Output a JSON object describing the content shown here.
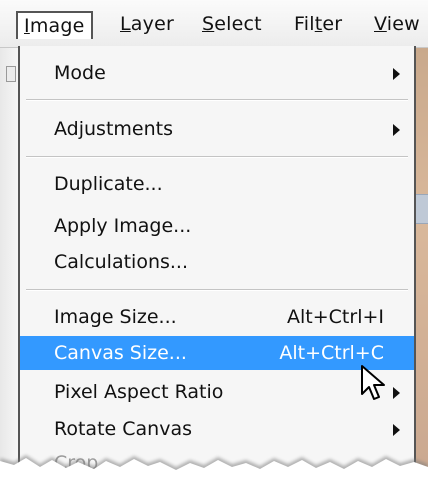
{
  "menubar": {
    "items": [
      {
        "label": "Image",
        "underline_index": 0
      },
      {
        "label": "Layer",
        "underline_index": 0
      },
      {
        "label": "Select",
        "underline_index": 0
      },
      {
        "label": "Filter",
        "underline_index": 3
      },
      {
        "label": "View",
        "underline_index": 0
      }
    ]
  },
  "menu": {
    "mode": {
      "label": "Mode"
    },
    "adjustments": {
      "label": "Adjustments"
    },
    "duplicate": {
      "label": "Duplicate..."
    },
    "apply_image": {
      "label": "Apply Image..."
    },
    "calculations": {
      "label": "Calculations..."
    },
    "image_size": {
      "label": "Image Size...",
      "shortcut": "Alt+Ctrl+I"
    },
    "canvas_size": {
      "label": "Canvas Size...",
      "shortcut": "Alt+Ctrl+C"
    },
    "pixel_aspect_ratio": {
      "label": "Pixel Aspect Ratio"
    },
    "rotate_canvas": {
      "label": "Rotate Canvas"
    },
    "crop": {
      "label": "Crop"
    }
  },
  "colors": {
    "highlight": "#3399ff",
    "menu_background": "#f6f6f6"
  },
  "icons": {
    "submenu": "triangle-right-icon",
    "cursor": "mouse-pointer-icon"
  }
}
